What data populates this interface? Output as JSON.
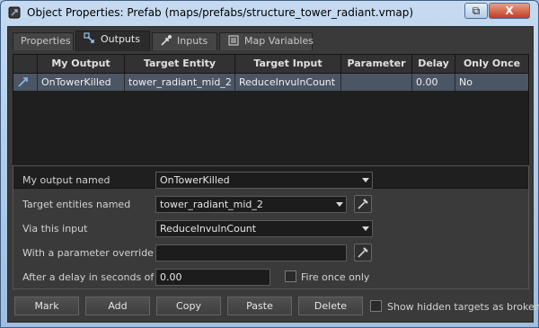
{
  "window": {
    "title": "Object Properties: Prefab (maps/prefabs/structure_tower_radiant.vmap)",
    "restore_glyph": "⧉",
    "close_glyph": "X"
  },
  "tabs": [
    {
      "label": "Properties",
      "icon": ""
    },
    {
      "label": "Outputs",
      "icon": "outputs-icon"
    },
    {
      "label": "Inputs",
      "icon": "inputs-icon"
    },
    {
      "label": "Map Variables",
      "icon": "map-variables-icon"
    }
  ],
  "active_tab": "Outputs",
  "table": {
    "columns": [
      "My Output",
      "Target Entity",
      "Target Input",
      "Parameter",
      "Delay",
      "Only Once"
    ],
    "rows": [
      {
        "my_output": "OnTowerKilled",
        "target_entity": "tower_radiant_mid_2",
        "target_input": "ReduceInvulnCount",
        "parameter": "",
        "delay": "0.00",
        "only_once": "No"
      }
    ]
  },
  "form": {
    "my_output_label": "My output named",
    "my_output_value": "OnTowerKilled",
    "target_entities_label": "Target entities named",
    "target_entities_value": "tower_radiant_mid_2",
    "via_input_label": "Via this input",
    "via_input_value": "ReduceInvulnCount",
    "param_override_label": "With a parameter override of",
    "param_override_value": "",
    "delay_label": "After a delay in seconds of",
    "delay_value": "0.00",
    "fire_once_label": "Fire once only",
    "fire_once_checked": false
  },
  "buttons": {
    "mark": "Mark",
    "add": "Add",
    "copy": "Copy",
    "paste": "Paste",
    "delete": "Delete"
  },
  "show_hidden": {
    "label": "Show hidden targets as broken",
    "checked": false
  },
  "colors": {
    "selection_row": "#4b5564",
    "close_button": "#c13b21",
    "panel_bg": "#3a3a3a"
  }
}
